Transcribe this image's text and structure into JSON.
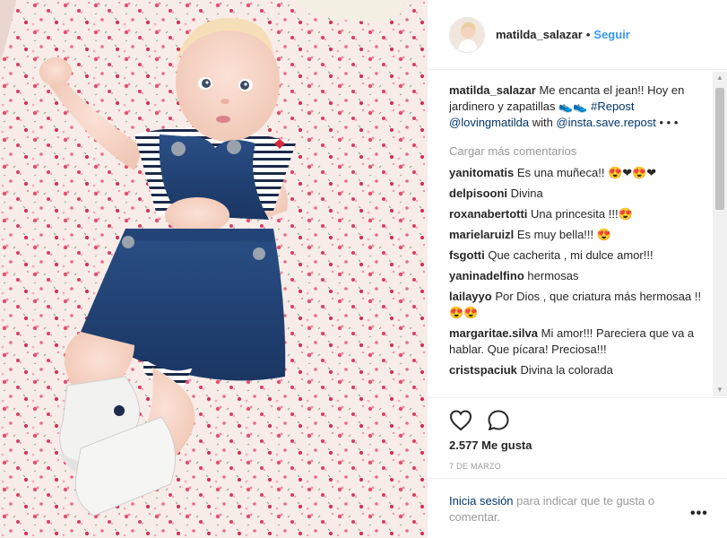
{
  "post": {
    "photo_alt": "Bebé con jardinero de jean y zapatillas blancas",
    "header": {
      "username": "matilda_salazar",
      "separator": "•",
      "follow_label": "Seguir"
    },
    "caption": {
      "username": "matilda_salazar",
      "text_before": " Me encanta el jean!! Hoy en jardinero y zapatillas 👟👟 ",
      "hashtag": "#Repost",
      "mention_1": "@lovingmatilda",
      "text_middle": " with ",
      "mention_2": "@insta.save.repost",
      "text_after": " • • •"
    },
    "load_more_label": "Cargar más comentarios",
    "comments": [
      {
        "user": "yanitomatis",
        "text": "Es una muñeca!! 😍❤😍❤"
      },
      {
        "user": "delpisooni",
        "text": "Divina"
      },
      {
        "user": "roxanabertotti",
        "text": "Una princesita !!!😍"
      },
      {
        "user": "marielaruizl",
        "text": "Es muy bella!!! 😍"
      },
      {
        "user": "fsgotti",
        "text": "Que cacherita , mi dulce amor!!!"
      },
      {
        "user": "yaninadelfino",
        "text": "hermosas"
      },
      {
        "user": "lailayyo",
        "text": "Por Dios , que criatura más hermosaa !! 😍😍"
      },
      {
        "user": "margaritae.silva",
        "text": "Mi amor!!! Pareciera que va a hablar. Que pícara! Preciosa!!!"
      },
      {
        "user": "cristspaciuk",
        "text": "Divina la colorada"
      }
    ],
    "icons": {
      "like": "heart-outline-icon",
      "comment": "speech-bubble-icon"
    },
    "likes_label": "2.577 Me gusta",
    "date_label": "7 DE MARZO",
    "login": {
      "link_label": "Inicia sesión",
      "rest_label": " para indicar que te gusta o comentar."
    },
    "more_label": "•••",
    "scroll_up": "▲",
    "scroll_down": "▼",
    "colors": {
      "link_blue": "#3897f0",
      "dark_link": "#003569",
      "muted": "#999999",
      "text": "#262626",
      "border": "#efefef"
    }
  }
}
